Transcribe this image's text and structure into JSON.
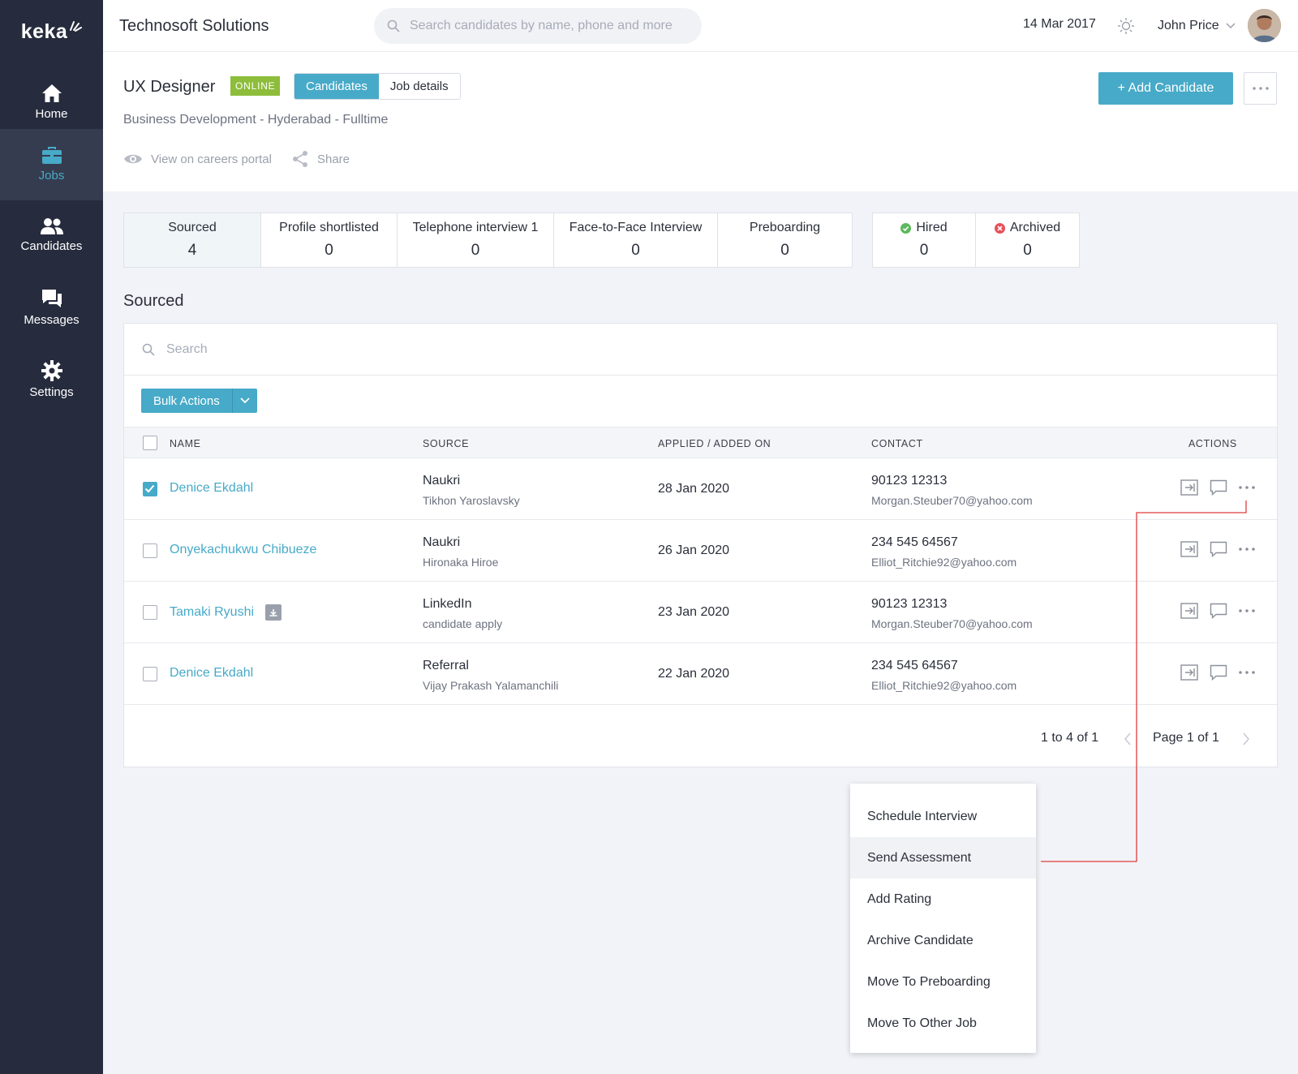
{
  "app": {
    "logo": "keka",
    "company": "Technosoft Solutions",
    "search_placeholder": "Search candidates by name, phone and more",
    "date": "14 Mar 2017",
    "user_name": "John Price"
  },
  "sidebar": {
    "items": [
      {
        "label": "Home",
        "icon": "home-icon"
      },
      {
        "label": "Jobs",
        "icon": "briefcase-icon",
        "active": true
      },
      {
        "label": "Candidates",
        "icon": "people-icon"
      },
      {
        "label": "Messages",
        "icon": "chat-icon"
      },
      {
        "label": "Settings",
        "icon": "gear-icon"
      }
    ]
  },
  "job": {
    "title": "UX Designer",
    "status": "ONLINE",
    "tabs": [
      "Candidates",
      "Job details"
    ],
    "meta": "Business Development - Hyderabad - Fulltime",
    "view_portal": "View on careers portal",
    "share": "Share",
    "add_candidate": "+ Add Candidate"
  },
  "stages": [
    {
      "label": "Sourced",
      "count": "4"
    },
    {
      "label": "Profile shortlisted",
      "count": "0"
    },
    {
      "label": "Telephone interview 1",
      "count": "0"
    },
    {
      "label": "Face-to-Face Interview",
      "count": "0"
    },
    {
      "label": "Preboarding",
      "count": "0"
    }
  ],
  "outcomes": [
    {
      "label": "Hired",
      "count": "0",
      "color": "#5cb85c"
    },
    {
      "label": "Archived",
      "count": "0",
      "color": "#e8505b"
    }
  ],
  "section_title": "Sourced",
  "table": {
    "search_placeholder": "Search",
    "bulk_actions": "Bulk Actions",
    "headers": [
      "NAME",
      "SOURCE",
      "APPLIED / ADDED ON",
      "CONTACT",
      "ACTIONS"
    ],
    "rows": [
      {
        "name": "Denice Ekdahl",
        "source": "Naukri",
        "source_by": "Tikhon Yaroslavsky",
        "date": "28 Jan 2020",
        "phone": "90123 12313",
        "email": "Morgan.Steuber70@yahoo.com",
        "checked": true
      },
      {
        "name": "Onyekachukwu Chibueze",
        "source": "Naukri",
        "source_by": "Hironaka Hiroe",
        "date": "26 Jan 2020",
        "phone": "234 545 64567",
        "email": "Elliot_Ritchie92@yahoo.com",
        "checked": false
      },
      {
        "name": "Tamaki Ryushi",
        "source": "LinkedIn",
        "source_by": "candidate apply",
        "date": "23 Jan 2020",
        "phone": "90123 12313",
        "email": "Morgan.Steuber70@yahoo.com",
        "checked": false
      },
      {
        "name": "Denice Ekdahl",
        "source": "Referral",
        "source_by": "Vijay Prakash Yalamanchili",
        "date": "22 Jan 2020",
        "phone": "234 545 64567",
        "email": "Elliot_Ritchie92@yahoo.com",
        "checked": false
      }
    ],
    "range": "1 to 4 of 1",
    "page": "Page 1 of 1"
  },
  "menu": {
    "items": [
      "Schedule Interview",
      "Send Assessment",
      "Add Rating",
      "Archive Candidate",
      "Move To Preboarding",
      "Move To Other Job"
    ]
  }
}
